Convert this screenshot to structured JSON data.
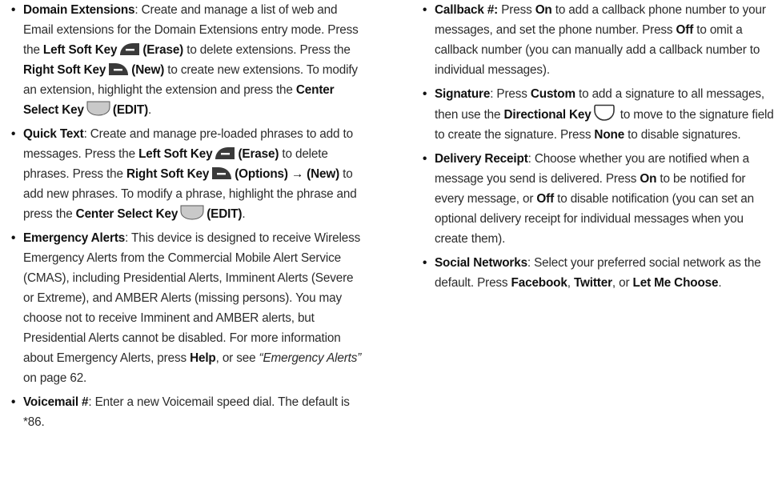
{
  "left": {
    "domain_ext": {
      "term": "Domain Extensions",
      "t1": ": Create and manage a list of web and Email extensions for the Domain Extensions entry mode. Press the ",
      "lsk": "Left Soft Key",
      "erase": "(Erase)",
      "t2": " to delete extensions. Press the ",
      "rsk": "Right Soft Key",
      "new": "(New)",
      "t3": " to create new extensions. To modify an extension, highlight the extension and press the ",
      "csk": "Center Select Key",
      "edit": "(EDIT)",
      "t4": "."
    },
    "quick_text": {
      "term": "Quick Text",
      "t1": ": Create and manage pre-loaded phrases to add to messages. Press the ",
      "lsk": "Left Soft Key",
      "erase": "(Erase)",
      "t2": " to delete phrases. Press the ",
      "rsk": "Right Soft Key",
      "options": "(Options) → (New)",
      "t3": " to add new phrases. To modify a phrase, highlight the phrase and press the ",
      "csk": "Center Select Key",
      "edit": "(EDIT)",
      "t4": "."
    },
    "emergency": {
      "term": "Emergency Alerts",
      "t1": ": This device is designed to receive Wireless Emergency Alerts from the Commercial Mobile Alert Service (CMAS), including Presidential Alerts, Imminent Alerts (Severe or Extreme), and AMBER Alerts (missing persons). You may choose not to receive Imminent and AMBER alerts, but Presidential Alerts cannot be disabled. For more information about Emergency Alerts, press ",
      "help": "Help",
      "t2": ", or see ",
      "link": "“Emergency Alerts”",
      "t3": " on page 62."
    },
    "voicemail": {
      "term": "Voicemail #",
      "t1": ": Enter a new Voicemail speed dial. The default is *86."
    }
  },
  "right": {
    "callback": {
      "term": "Callback #:",
      "t1": " Press ",
      "on": "On",
      "t2": " to add a callback phone number to your messages, and set the phone number. Press ",
      "off": "Off",
      "t3": " to omit a callback number (you can manually add a callback number to individual messages)."
    },
    "signature": {
      "term": "Signature",
      "t1": ": Press ",
      "custom": "Custom",
      "t2": "  to add a signature to all messages, then use the ",
      "dir": "Directional Key",
      "t3": " to move to the signature field to create the signature. Press ",
      "none": "None",
      "t4": " to disable signatures."
    },
    "delivery": {
      "term": "Delivery Receipt",
      "t1": ": Choose whether you are notified when a message you send is delivered. Press ",
      "on": "On",
      "t2": " to be notified for every message, or ",
      "off": "Off",
      "t3": " to disable notification (you can set an optional delivery receipt for individual messages when you create them)."
    },
    "social": {
      "term": "Social Networks",
      "t1": ": Select your preferred social network as the default. Press ",
      "facebook": "Facebook",
      "t2": ", ",
      "twitter": "Twitter",
      "t3": ", or ",
      "letme": "Let Me Choose",
      "t4": "."
    }
  },
  "icons": {
    "left_soft_key": "left-soft-key-icon",
    "right_soft_key": "right-soft-key-icon",
    "center_select_key": "center-select-key-icon",
    "directional_key": "directional-key-icon"
  }
}
